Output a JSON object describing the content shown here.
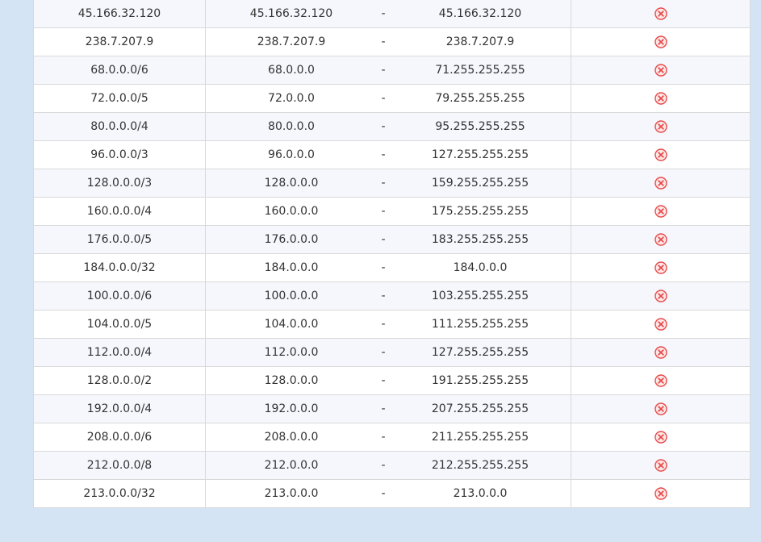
{
  "rows": [
    {
      "cidr": "45.166.32.120",
      "start": "45.166.32.120",
      "sep": "-",
      "end": "45.166.32.120"
    },
    {
      "cidr": "238.7.207.9",
      "start": "238.7.207.9",
      "sep": "-",
      "end": "238.7.207.9"
    },
    {
      "cidr": "68.0.0.0/6",
      "start": "68.0.0.0",
      "sep": "-",
      "end": "71.255.255.255"
    },
    {
      "cidr": "72.0.0.0/5",
      "start": "72.0.0.0",
      "sep": "-",
      "end": "79.255.255.255"
    },
    {
      "cidr": "80.0.0.0/4",
      "start": "80.0.0.0",
      "sep": "-",
      "end": "95.255.255.255"
    },
    {
      "cidr": "96.0.0.0/3",
      "start": "96.0.0.0",
      "sep": "-",
      "end": "127.255.255.255"
    },
    {
      "cidr": "128.0.0.0/3",
      "start": "128.0.0.0",
      "sep": "-",
      "end": "159.255.255.255"
    },
    {
      "cidr": "160.0.0.0/4",
      "start": "160.0.0.0",
      "sep": "-",
      "end": "175.255.255.255"
    },
    {
      "cidr": "176.0.0.0/5",
      "start": "176.0.0.0",
      "sep": "-",
      "end": "183.255.255.255"
    },
    {
      "cidr": "184.0.0.0/32",
      "start": "184.0.0.0",
      "sep": "-",
      "end": "184.0.0.0"
    },
    {
      "cidr": "100.0.0.0/6",
      "start": "100.0.0.0",
      "sep": "-",
      "end": "103.255.255.255"
    },
    {
      "cidr": "104.0.0.0/5",
      "start": "104.0.0.0",
      "sep": "-",
      "end": "111.255.255.255"
    },
    {
      "cidr": "112.0.0.0/4",
      "start": "112.0.0.0",
      "sep": "-",
      "end": "127.255.255.255"
    },
    {
      "cidr": "128.0.0.0/2",
      "start": "128.0.0.0",
      "sep": "-",
      "end": "191.255.255.255"
    },
    {
      "cidr": "192.0.0.0/4",
      "start": "192.0.0.0",
      "sep": "-",
      "end": "207.255.255.255"
    },
    {
      "cidr": "208.0.0.0/6",
      "start": "208.0.0.0",
      "sep": "-",
      "end": "211.255.255.255"
    },
    {
      "cidr": "212.0.0.0/8",
      "start": "212.0.0.0",
      "sep": "-",
      "end": "212.255.255.255"
    },
    {
      "cidr": "213.0.0.0/32",
      "start": "213.0.0.0",
      "sep": "-",
      "end": "213.0.0.0"
    }
  ],
  "icons": {
    "delete": "delete-icon"
  },
  "colors": {
    "page_background": "#d4e4f5",
    "row_alt": "#f5f7fc",
    "row": "#ffffff",
    "border": "#d9d9d9",
    "delete_red": "#e84a4a",
    "delete_pink_fill": "#fde8e8"
  }
}
